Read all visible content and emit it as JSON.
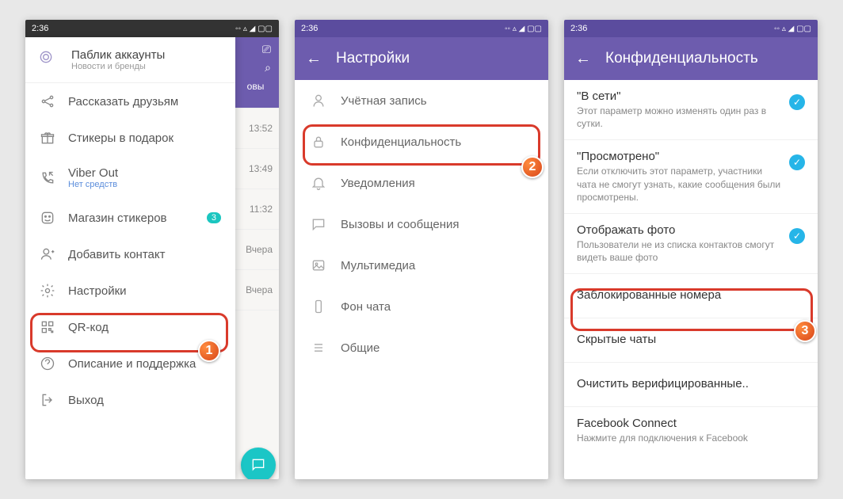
{
  "status": {
    "time": "2:36"
  },
  "screen1": {
    "header": {
      "title": "Паблик аккаунты",
      "subtitle": "Новости и бренды"
    },
    "bg_header_text": "овы",
    "chat_times": [
      "13:52",
      "13:49",
      "11:32",
      "Вчера",
      "Вчера"
    ],
    "items": [
      {
        "label": "Рассказать друзьям"
      },
      {
        "label": "Стикеры в подарок"
      },
      {
        "label": "Viber Out",
        "sub": "Нет средств"
      },
      {
        "label": "Магазин стикеров",
        "badge": "3"
      },
      {
        "label": "Добавить контакт"
      },
      {
        "label": "Настройки"
      },
      {
        "label": "QR-код"
      },
      {
        "label": "Описание и поддержка"
      },
      {
        "label": "Выход"
      }
    ],
    "step": "1"
  },
  "screen2": {
    "title": "Настройки",
    "items": [
      {
        "label": "Учётная запись"
      },
      {
        "label": "Конфиденциальность"
      },
      {
        "label": "Уведомления"
      },
      {
        "label": "Вызовы и сообщения"
      },
      {
        "label": "Мультимедиа"
      },
      {
        "label": "Фон чата"
      },
      {
        "label": "Общие"
      }
    ],
    "step": "2"
  },
  "screen3": {
    "title": "Конфиденциальность",
    "items": [
      {
        "title": "\"В сети\"",
        "sub": "Этот параметр можно изменять один раз в сутки.",
        "checked": true
      },
      {
        "title": "\"Просмотрено\"",
        "sub": "Если отключить этот параметр, участники чата не смогут узнать, какие сообщения были просмотрены.",
        "checked": true
      },
      {
        "title": "Отображать фото",
        "sub": "Пользователи не из списка контактов смогут видеть ваше фото",
        "checked": true
      },
      {
        "title": "Заблокированные номера"
      },
      {
        "title": "Скрытые чаты"
      },
      {
        "title": "Очистить верифицированные.."
      },
      {
        "title": "Facebook Connect",
        "sub": "Нажмите для подключения к Facebook"
      }
    ],
    "step": "3"
  }
}
